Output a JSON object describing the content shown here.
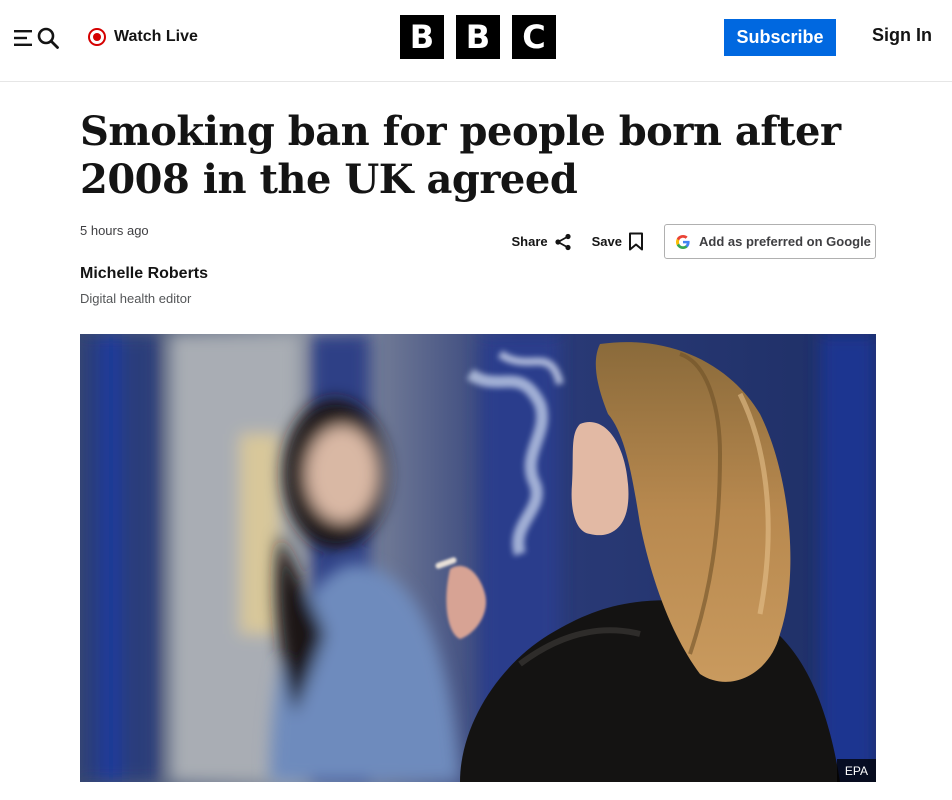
{
  "header": {
    "watch_live": "Watch Live",
    "logo_letters": [
      "B",
      "B",
      "C"
    ],
    "subscribe": "Subscribe",
    "sign_in": "Sign In",
    "colors": {
      "live_red": "#d50000",
      "subscribe_blue": "#0068e0"
    }
  },
  "article": {
    "headline": "Smoking ban for people born after 2008 in the UK agreed",
    "timestamp": "5 hours ago",
    "share": "Share",
    "save": "Save",
    "google_button": "Add as preferred on Google",
    "author": "Michelle Roberts",
    "author_role": "Digital health editor",
    "image_credit": "EPA"
  },
  "icons": {
    "menu": "menu-icon",
    "search": "search-icon",
    "live": "live-dot-icon",
    "share": "share-icon",
    "save": "bookmark-icon",
    "google": "google-icon"
  }
}
